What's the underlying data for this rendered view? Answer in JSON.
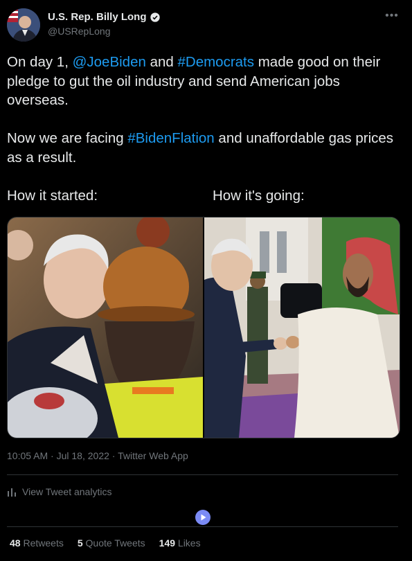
{
  "author": {
    "name": "U.S. Rep. Billy Long",
    "handle": "@USRepLong",
    "verified": true,
    "avatar": "avatar-portrait"
  },
  "more_icon": "more-horizontal-icon",
  "tweet": {
    "line1_pre": "On day 1, ",
    "mention": "@JoeBiden",
    "line1_mid": " and ",
    "hashtag1": "#Democrats",
    "line1_post": " made good on their pledge to gut the oil industry and send American jobs overseas.",
    "line2_pre": "Now we are facing ",
    "hashtag2": "#BidenFlation",
    "line2_post": " and unaffordable gas prices as a result.",
    "label_left": "How it started:",
    "label_right": "How it's going:"
  },
  "colors": {
    "link": "#1d9bf0",
    "background": "#000000",
    "muted": "#71767b"
  },
  "meta": {
    "time": "10:05 AM",
    "date": "Jul 18, 2022",
    "source": "Twitter Web App"
  },
  "analytics": {
    "label": "View Tweet analytics",
    "icon": "bar-chart-icon"
  },
  "stats": {
    "retweets_count": "48",
    "retweets_label": "Retweets",
    "quotes_count": "5",
    "quotes_label": "Quote Tweets",
    "likes_count": "149",
    "likes_label": "Likes"
  }
}
